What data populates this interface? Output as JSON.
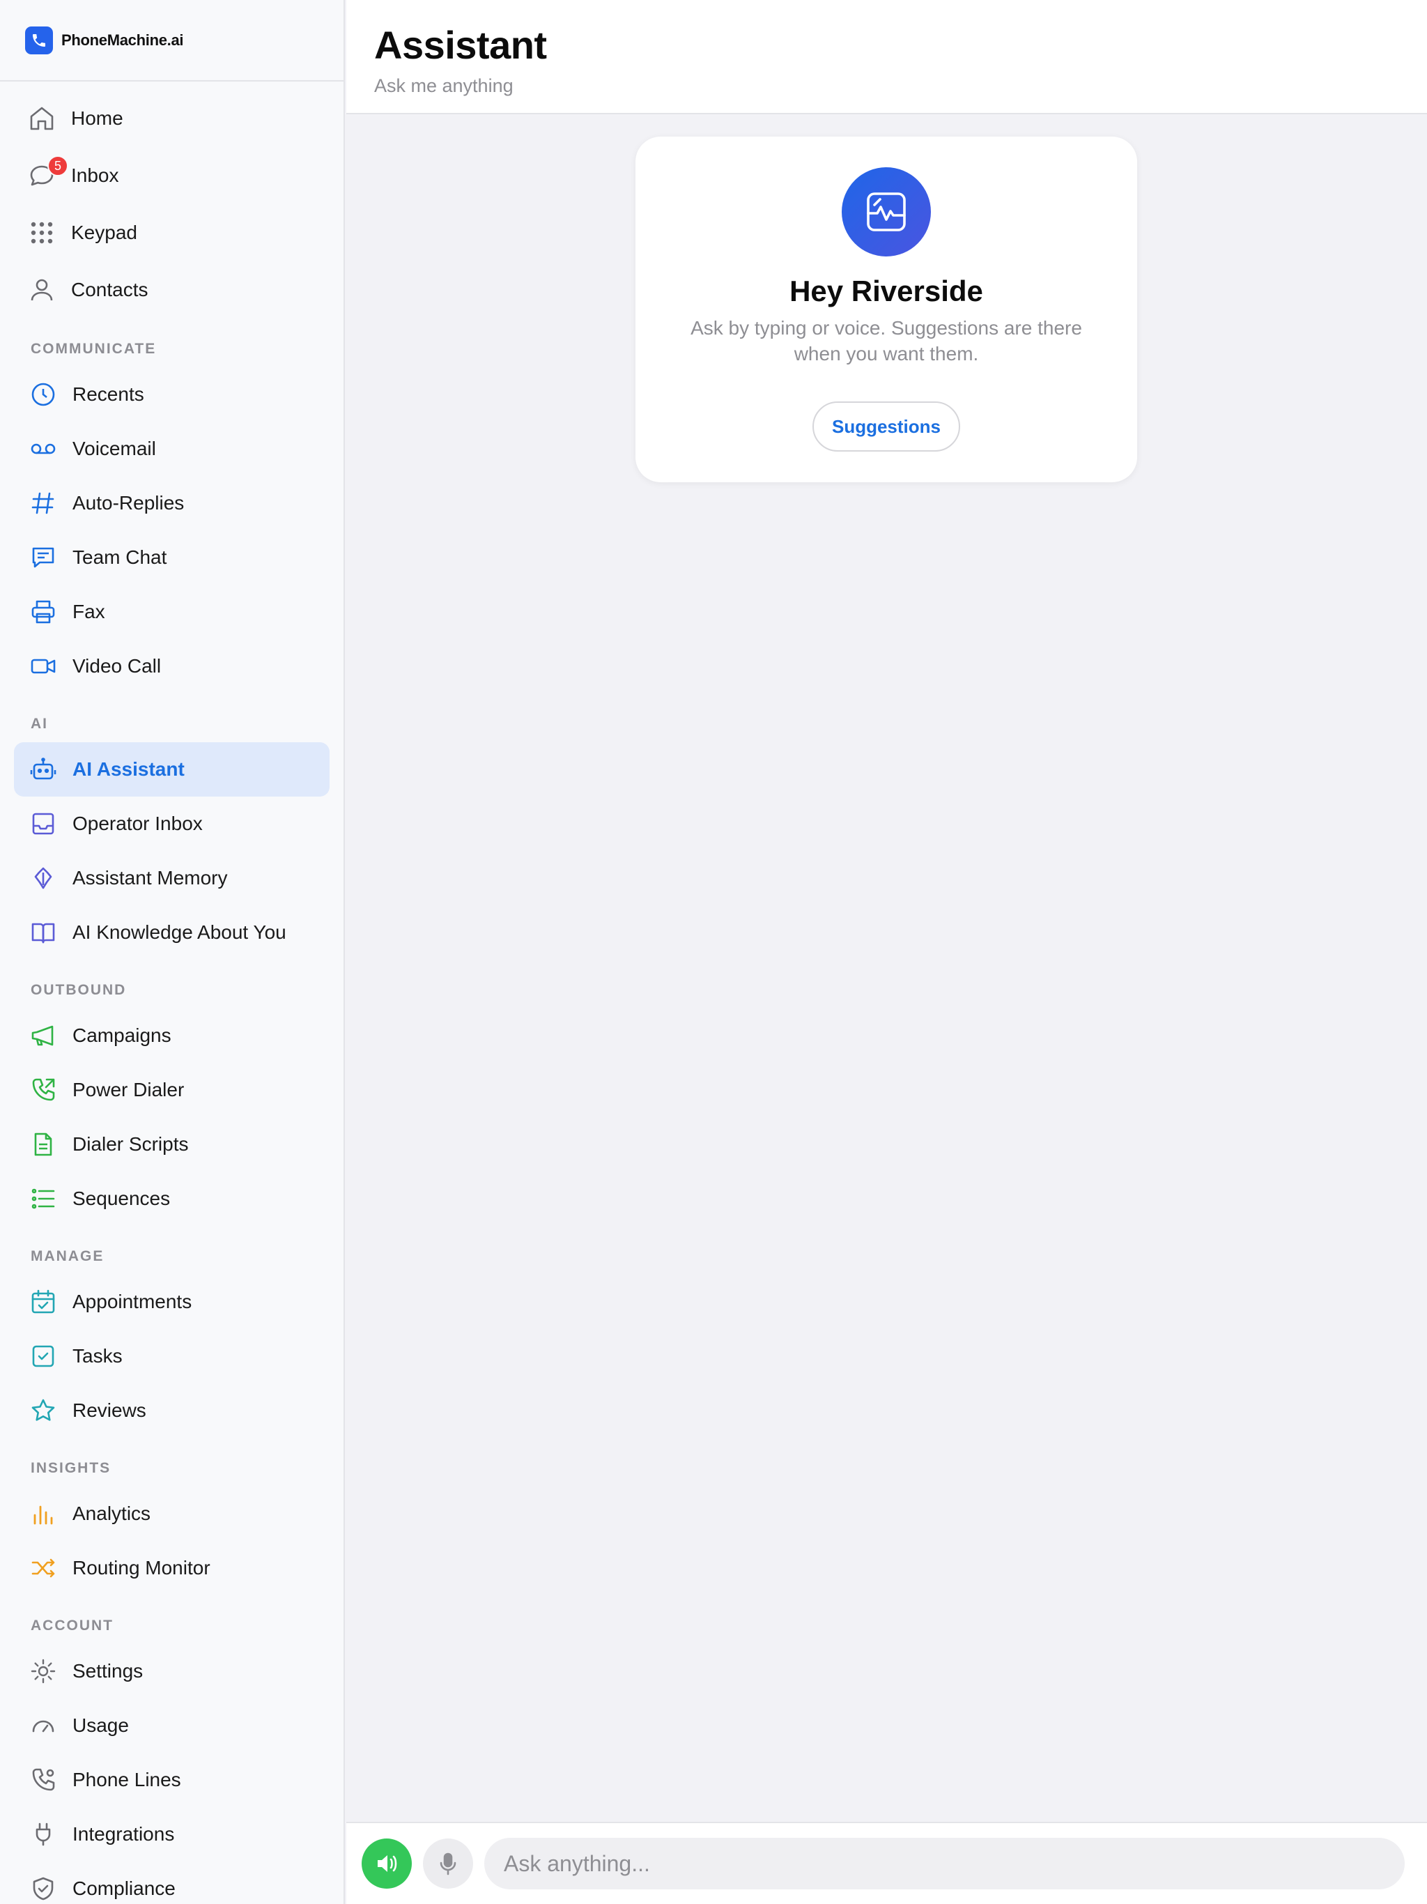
{
  "brand": {
    "name": "PhoneMachine.ai"
  },
  "sidebar": {
    "top_items": [
      {
        "label": "Home",
        "icon": "home-icon"
      },
      {
        "label": "Inbox",
        "icon": "chat-bubble-icon",
        "badge": "5"
      },
      {
        "label": "Keypad",
        "icon": "keypad-icon"
      },
      {
        "label": "Contacts",
        "icon": "person-icon"
      }
    ],
    "sections": [
      {
        "title": "COMMUNICATE",
        "items": [
          {
            "label": "Recents",
            "icon": "clock-icon"
          },
          {
            "label": "Voicemail",
            "icon": "voicemail-icon"
          },
          {
            "label": "Auto-Replies",
            "icon": "hash-icon"
          },
          {
            "label": "Team Chat",
            "icon": "message-square-icon"
          },
          {
            "label": "Fax",
            "icon": "printer-icon"
          },
          {
            "label": "Video Call",
            "icon": "video-icon"
          }
        ]
      },
      {
        "title": "AI",
        "items": [
          {
            "label": "AI Assistant",
            "icon": "robot-icon",
            "active": true
          },
          {
            "label": "Operator Inbox",
            "icon": "inbox-tray-icon"
          },
          {
            "label": "Assistant Memory",
            "icon": "brain-icon"
          },
          {
            "label": "AI Knowledge About You",
            "icon": "book-icon"
          }
        ]
      },
      {
        "title": "OUTBOUND",
        "items": [
          {
            "label": "Campaigns",
            "icon": "megaphone-icon"
          },
          {
            "label": "Power Dialer",
            "icon": "phone-outgoing-icon"
          },
          {
            "label": "Dialer Scripts",
            "icon": "document-icon"
          },
          {
            "label": "Sequences",
            "icon": "list-icon"
          }
        ]
      },
      {
        "title": "MANAGE",
        "items": [
          {
            "label": "Appointments",
            "icon": "calendar-check-icon"
          },
          {
            "label": "Tasks",
            "icon": "checkbox-icon"
          },
          {
            "label": "Reviews",
            "icon": "star-icon"
          }
        ]
      },
      {
        "title": "INSIGHTS",
        "items": [
          {
            "label": "Analytics",
            "icon": "bar-chart-icon"
          },
          {
            "label": "Routing Monitor",
            "icon": "shuffle-icon"
          }
        ]
      },
      {
        "title": "ACCOUNT",
        "items": [
          {
            "label": "Settings",
            "icon": "gear-icon"
          },
          {
            "label": "Usage",
            "icon": "gauge-icon"
          },
          {
            "label": "Phone Lines",
            "icon": "phone-lines-icon"
          },
          {
            "label": "Integrations",
            "icon": "plug-icon"
          },
          {
            "label": "Compliance",
            "icon": "shield-check-icon"
          }
        ]
      }
    ]
  },
  "header": {
    "title": "Assistant",
    "subtitle": "Ask me anything"
  },
  "welcome": {
    "title": "Hey Riverside",
    "text": "Ask by typing or voice. Suggestions are there when you want them.",
    "suggestions_label": "Suggestions"
  },
  "composer": {
    "placeholder": "Ask anything..."
  },
  "colors": {
    "accent": "#1b6fe0",
    "active_bg": "#dfe9fb",
    "badge": "#ee3b3b",
    "speaker": "#34c759",
    "communicate_icons": "#1b6fe0",
    "ai_icons": "#5b5bd6",
    "outbound_icons": "#2fb344",
    "manage_icons": "#22a6b3",
    "insights_icons": "#f0a020",
    "account_icons": "#6b6b70"
  }
}
